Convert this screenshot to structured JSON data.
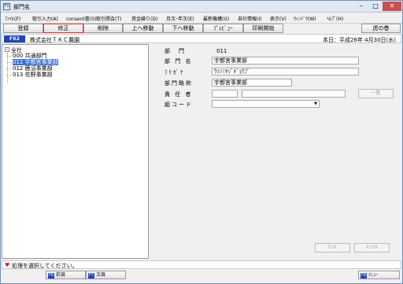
{
  "window": {
    "title": "部門名",
    "app_icon_text": "FX"
  },
  "menu": [
    "ﾌｧｲﾙ(F)",
    "取引入力(A)",
    "consent書(S)",
    "取引照会(T)",
    "資金繰り(D)",
    "月次･年次(E)",
    "最新機構(G)",
    "自社情報(I)",
    "表示(V)",
    "ｳｨﾝﾄﾞｳ(W)",
    "ﾍﾙﾌﾟ(H)"
  ],
  "toolbar": {
    "register": "登録",
    "modify": "修正",
    "delete": "削除",
    "move_up": "上へ移動",
    "move_down": "下へ移動",
    "preview": "ﾌﾟﾚﾋﾞｭｰ",
    "print": "印刷開始",
    "tiger": "虎の巻"
  },
  "infobar": {
    "badge": "FX2",
    "company": "株式会社ＴＫＣ農園",
    "date": "本日：平成26年 4月30日(水)"
  },
  "tree": {
    "root": "全社",
    "items": [
      {
        "code": "000",
        "name": "共通部門"
      },
      {
        "code": "011",
        "name": "宇都宮事業部"
      },
      {
        "code": "012",
        "name": "鹿沼事業部"
      },
      {
        "code": "013",
        "name": "佐野事業部"
      }
    ]
  },
  "form": {
    "dept_label": "部　門",
    "dept_value": "011",
    "name_label": "部 門 名",
    "name_value": "宇都宮事業部",
    "kana_label": "ﾌﾘｶﾞﾅ",
    "kana_value": "ｳﾂﾉﾐﾔｼﾞｷﾞｮｳﾌﾞ",
    "abbr_label": "部門略称",
    "abbr_value": "宇都宮事業部",
    "manager_label": "責 任 者",
    "manager_code": "",
    "manager_name": "",
    "list_button": "一覧",
    "group_label": "組コード",
    "group_value": "",
    "ok_button": "ＯＫ",
    "cancel_button": "ｷｬﾝｾﾙ"
  },
  "status": {
    "message": "処理を選択してください。"
  },
  "fkeys": [
    {
      "key": "F6",
      "label": "前頁"
    },
    {
      "key": "F7",
      "label": "次頁"
    },
    {
      "key": "F8",
      "label": "ﾒﾆｭｰ"
    }
  ]
}
